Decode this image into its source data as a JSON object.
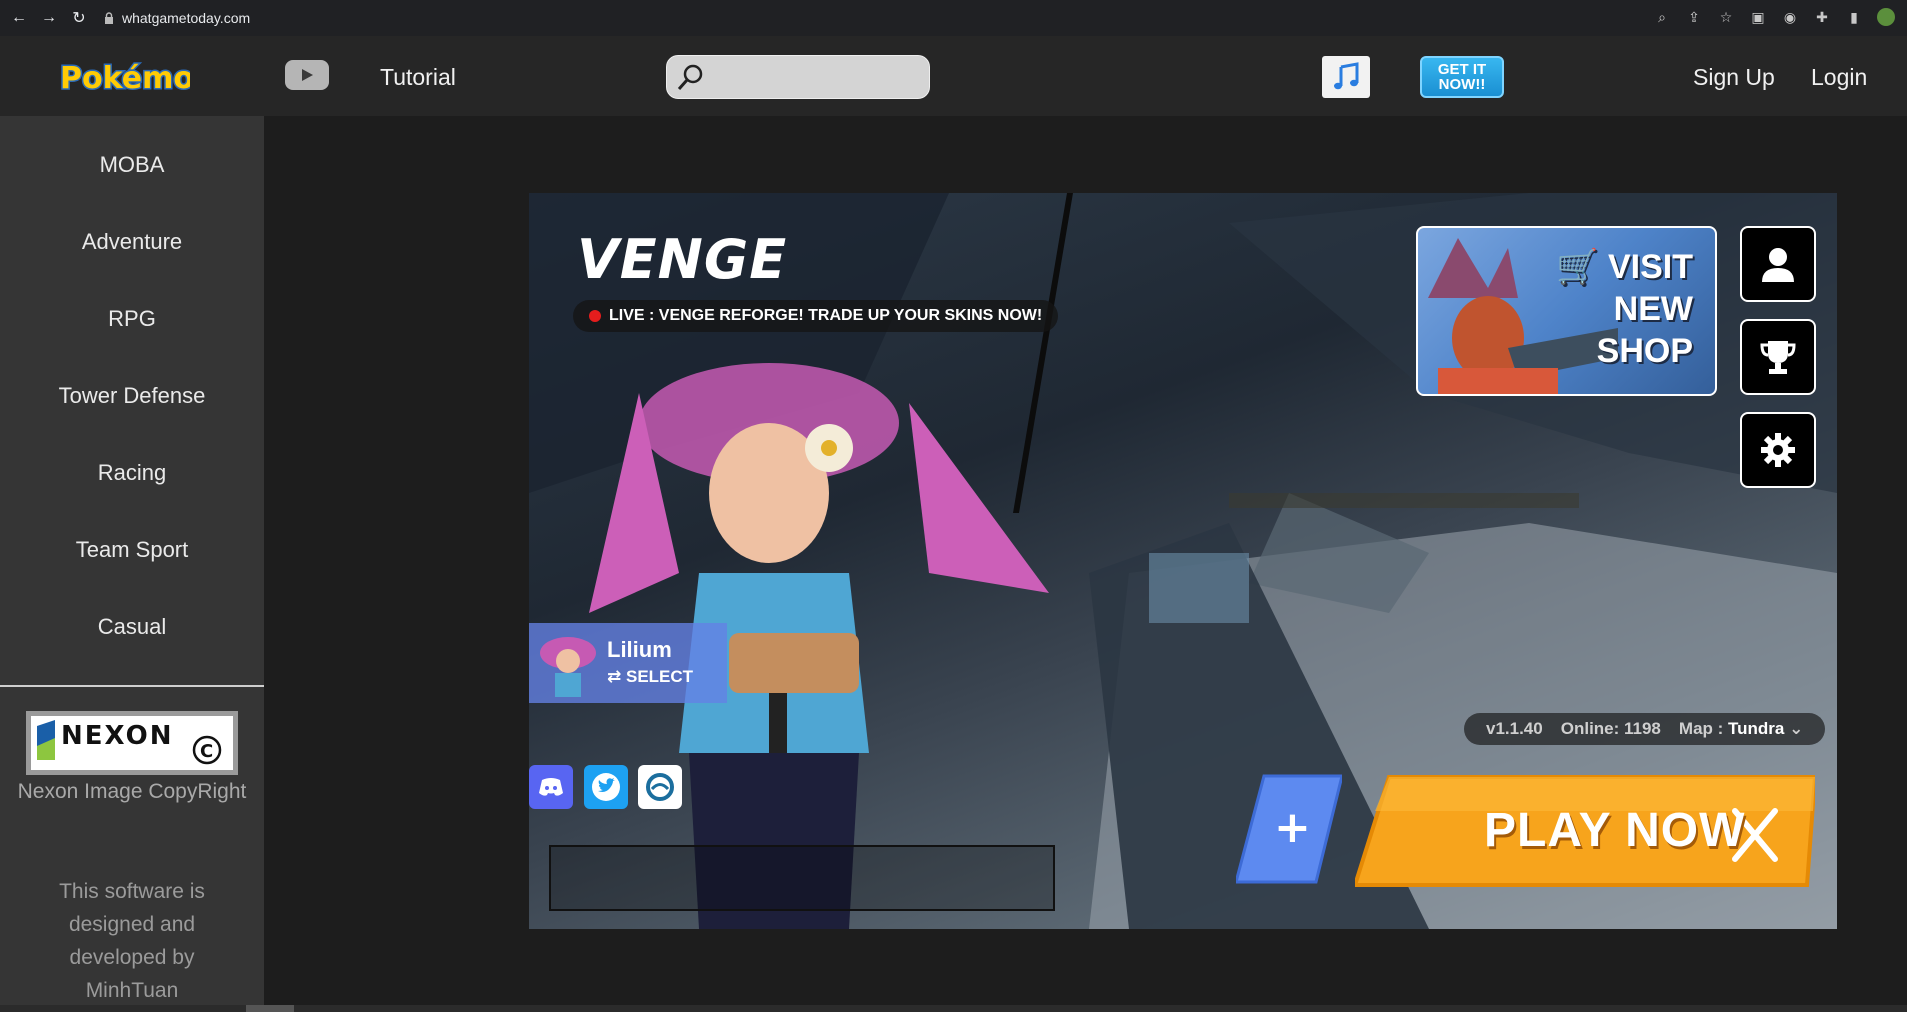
{
  "browser": {
    "url": "whatgametoday.com"
  },
  "header": {
    "logo_text": "Pokémon",
    "tutorial_label": "Tutorial",
    "search_placeholder": "",
    "get_it_label": "GET IT NOW!!",
    "signup_label": "Sign Up",
    "login_label": "Login"
  },
  "sidebar": {
    "items": [
      {
        "label": "MOBA"
      },
      {
        "label": "Adventure"
      },
      {
        "label": "RPG"
      },
      {
        "label": "Tower Defense"
      },
      {
        "label": "Racing"
      },
      {
        "label": "Team Sport"
      },
      {
        "label": "Casual"
      }
    ],
    "nexon_logo_text": "NEXON",
    "nexon_caption": "Nexon Image CopyRight",
    "developer_text": "This software is designed and developed by MinhTuan"
  },
  "game": {
    "title": "VENGE",
    "live_banner": "LIVE : VENGE REFORGE! TRADE UP YOUR SKINS NOW!",
    "shop": {
      "line1": "VISIT",
      "line2": "NEW",
      "line3": "SHOP"
    },
    "character": {
      "name": "Lilium",
      "select_label": "SELECT"
    },
    "info": {
      "version": "v1.1.40",
      "online": "Online: 1198",
      "map_label": "Map :",
      "map_value": "Tundra"
    },
    "play_label": "PLAY NOW",
    "plus_label": "+"
  },
  "colors": {
    "play_orange": "#f7a41c",
    "plus_blue": "#5d8af0",
    "live_red": "#e51d1d"
  }
}
